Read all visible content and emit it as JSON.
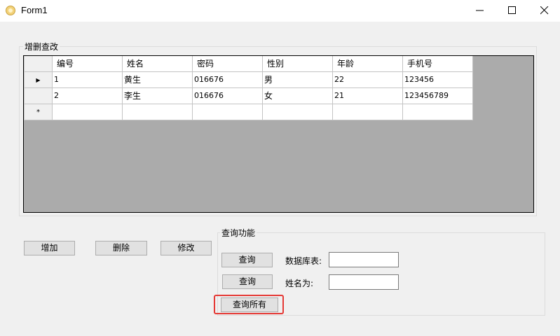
{
  "window": {
    "title": "Form1"
  },
  "crud_group": {
    "title": "增删查改"
  },
  "grid": {
    "columns": [
      "编号",
      "姓名",
      "密码",
      "性别",
      "年龄",
      "手机号"
    ],
    "rows": [
      [
        "1",
        "黄生",
        "016676",
        "男",
        "22",
        "123456"
      ],
      [
        "2",
        "李生",
        "016676",
        "女",
        "21",
        "123456789"
      ]
    ],
    "current_row_marker": "▶",
    "new_row_marker": "*"
  },
  "actions": {
    "add": "增加",
    "delete": "删除",
    "edit": "修改"
  },
  "query_group": {
    "title": "查询功能",
    "query1_button": "查询",
    "query2_button": "查询",
    "query_all_button": "查询所有",
    "table_label": "数据库表:",
    "table_value": "",
    "name_label": "姓名为:",
    "name_value": ""
  },
  "colors": {
    "highlight": "#e53935",
    "grid_background": "#ababab"
  }
}
